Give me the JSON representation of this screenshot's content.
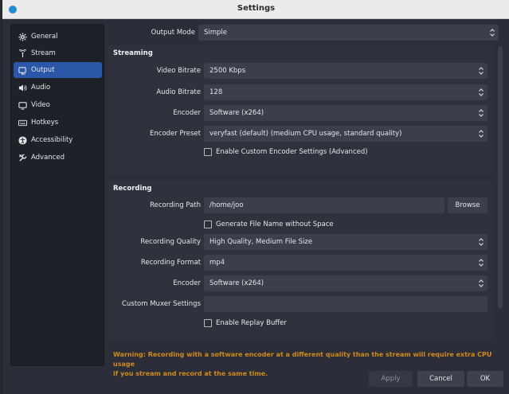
{
  "window": {
    "title": "Settings"
  },
  "sidebar": {
    "items": [
      {
        "label": "General",
        "icon": "gear-icon",
        "active": false
      },
      {
        "label": "Stream",
        "icon": "antenna-icon",
        "active": false
      },
      {
        "label": "Output",
        "icon": "output-icon",
        "active": true
      },
      {
        "label": "Audio",
        "icon": "speaker-icon",
        "active": false
      },
      {
        "label": "Video",
        "icon": "monitor-icon",
        "active": false
      },
      {
        "label": "Hotkeys",
        "icon": "keyboard-icon",
        "active": false
      },
      {
        "label": "Accessibility",
        "icon": "accessibility-icon",
        "active": false
      },
      {
        "label": "Advanced",
        "icon": "wrench-icon",
        "active": false
      }
    ]
  },
  "output_mode": {
    "label": "Output Mode",
    "value": "Simple"
  },
  "streaming": {
    "title": "Streaming",
    "video_bitrate": {
      "label": "Video Bitrate",
      "value": "2500 Kbps"
    },
    "audio_bitrate": {
      "label": "Audio Bitrate",
      "value": "128"
    },
    "encoder": {
      "label": "Encoder",
      "value": "Software (x264)"
    },
    "encoder_preset": {
      "label": "Encoder Preset",
      "value": "veryfast (default) (medium CPU usage, standard quality)"
    },
    "custom_encoder": {
      "label": "Enable Custom Encoder Settings (Advanced)",
      "checked": false
    }
  },
  "recording": {
    "title": "Recording",
    "path": {
      "label": "Recording Path",
      "value": "/home/joo"
    },
    "browse_label": "Browse",
    "no_space": {
      "label": "Generate File Name without Space",
      "checked": false
    },
    "quality": {
      "label": "Recording Quality",
      "value": "High Quality, Medium File Size"
    },
    "format": {
      "label": "Recording Format",
      "value": "mp4"
    },
    "encoder": {
      "label": "Encoder",
      "value": "Software (x264)"
    },
    "muxer": {
      "label": "Custom Muxer Settings",
      "value": ""
    },
    "replay_buffer": {
      "label": "Enable Replay Buffer",
      "checked": false
    }
  },
  "warning": {
    "line1": "Warning: Recording with a software encoder at a different quality than the stream will require extra CPU usage",
    "line2": "if you stream and record at the same time."
  },
  "footer": {
    "apply_label": "Apply",
    "cancel_label": "Cancel",
    "ok_label": "OK"
  },
  "colors": {
    "accent": "#2a57a8",
    "warning": "#d08a1a",
    "window_bg": "#2b2e38",
    "field_bg": "#3b3f4c"
  }
}
